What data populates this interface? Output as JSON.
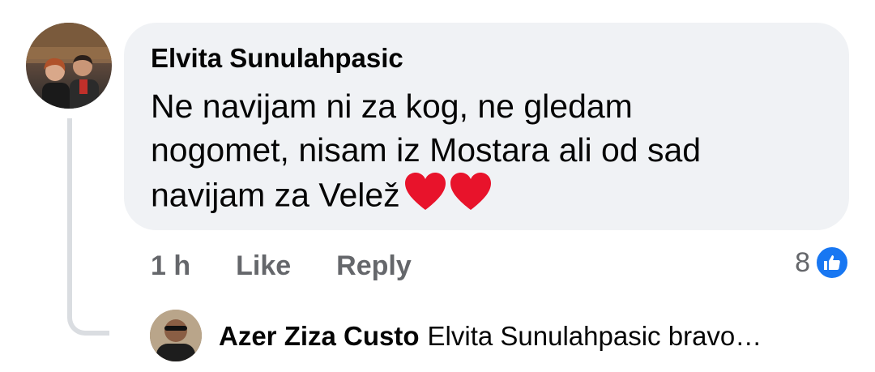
{
  "comment": {
    "author": "Elvita Sunulahpasic",
    "text_lines": [
      "Ne navijam ni za kog, ne gledam",
      "nogomet, nisam iz Mostara ali od sad",
      "navijam za Velež"
    ],
    "emoji": "red-heart-emoji x2",
    "time": "1 h",
    "like_label": "Like",
    "reply_label": "Reply",
    "reaction_count": "8",
    "reaction_icon": "like-thumb-icon"
  },
  "reply_preview": {
    "author": "Azer Ziza Custo",
    "text": "Elvita Sunulahpasic  bravo…"
  },
  "colors": {
    "bubble": "#f0f2f5",
    "meta_text": "#65676b",
    "like_blue": "#1877f2",
    "heart_red": "#e8132b",
    "thread_line": "#dadde1"
  }
}
